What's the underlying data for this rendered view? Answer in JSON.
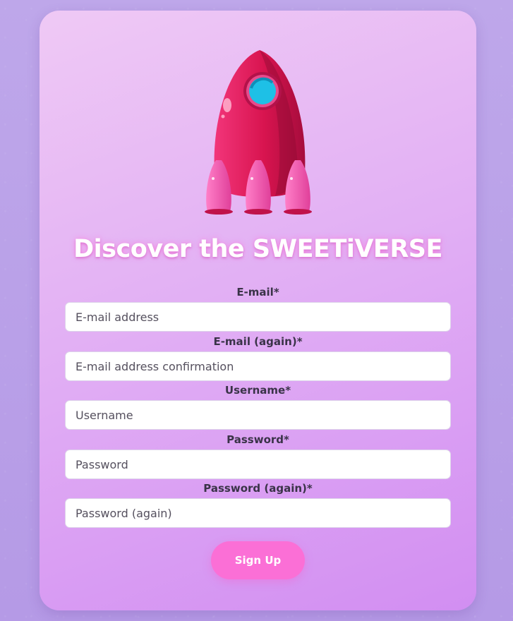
{
  "colors": {
    "background": "#b9a0e6",
    "card_top": "#efc9f5",
    "card_bottom": "#d28ef2",
    "button": "#fb6fd6",
    "rocket_body": "#e01e5a",
    "rocket_window": "#1ec0e6"
  },
  "hero": {
    "icon": "rocket-icon",
    "title": "Discover the SWEETiVERSE"
  },
  "form": {
    "fields": [
      {
        "label": "E-mail*",
        "placeholder": "E-mail address",
        "value": ""
      },
      {
        "label": "E-mail (again)*",
        "placeholder": "E-mail address confirmation",
        "value": ""
      },
      {
        "label": "Username*",
        "placeholder": "Username",
        "value": ""
      },
      {
        "label": "Password*",
        "placeholder": "Password",
        "value": ""
      },
      {
        "label": "Password (again)*",
        "placeholder": "Password (again)",
        "value": ""
      }
    ],
    "submit_label": "Sign Up"
  }
}
